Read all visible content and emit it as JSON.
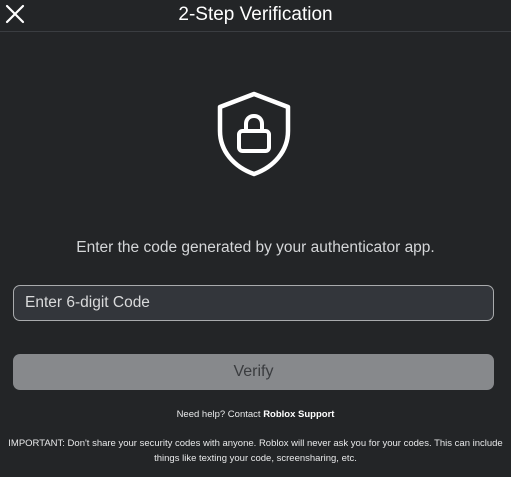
{
  "dialog": {
    "title": "2-Step Verification",
    "close_icon": "close-icon",
    "shield_icon": "shield-lock-icon",
    "instructions": "Enter the code generated by your authenticator app.",
    "code_input": {
      "value": "",
      "placeholder": "Enter 6-digit Code"
    },
    "verify_label": "Verify",
    "help_prefix": "Need help? Contact ",
    "help_link": "Roblox Support",
    "important_note": "IMPORTANT: Don't share your security codes with anyone. Roblox will never ask you for your codes. This can include things like texting your code, screensharing, etc."
  },
  "colors": {
    "background": "#232527",
    "input_background": "#33363b",
    "input_border": "#a9abad",
    "button_disabled": "#87898c",
    "button_text": "#3a3c3f",
    "text_primary": "#ffffff",
    "text_secondary": "#d4d6d8"
  }
}
